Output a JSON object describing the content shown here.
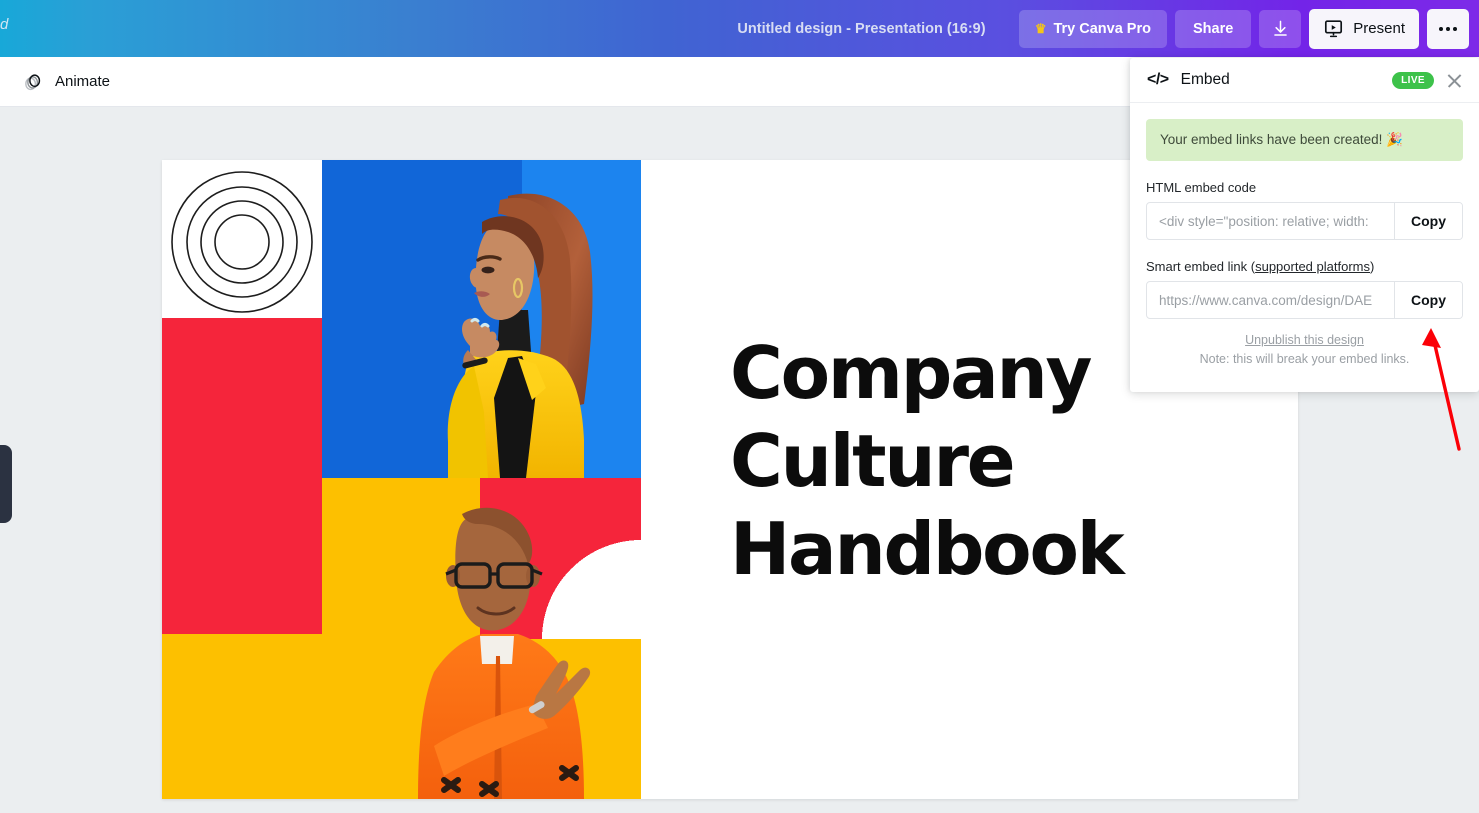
{
  "topbar": {
    "partial_text": "d",
    "doc_title": "Untitled design - Presentation (16:9)",
    "try_pro_label": "Try Canva Pro",
    "crown_icon": "crown-icon",
    "share_label": "Share",
    "download_icon": "download-icon",
    "present_label": "Present",
    "present_icon": "presentation-screen-icon",
    "more_icon": "more-options-icon",
    "gradient_start": "#18a8d8",
    "gradient_end": "#7d2ae8"
  },
  "toolbar": {
    "animate_label": "Animate",
    "animate_icon": "animate-circles-icon"
  },
  "canvas": {
    "background": "#ebeef0",
    "side_handle": "panel-collapse-handle"
  },
  "slide": {
    "title_lines": [
      "Company",
      "Culture",
      "Handbook"
    ],
    "colors": {
      "red": "#f5253b",
      "blue": "#1166d8",
      "blue_light": "#1c84ef",
      "yellow": "#fdc000",
      "orange": "#f4631e",
      "white": "#ffffff",
      "text": "#0c0c0c"
    }
  },
  "embed_panel": {
    "icon": "code-embed-icon",
    "title": "Embed",
    "live_badge": "LIVE",
    "close_icon": "close-icon",
    "success_message": "Your embed links have been created! 🎉",
    "html_embed": {
      "label": "HTML embed code",
      "value": "<div style=\"position: relative; width:",
      "copy_label": "Copy"
    },
    "smart_link": {
      "label_prefix": "Smart embed link (",
      "label_link": "supported platforms",
      "label_suffix": ")",
      "value": "https://www.canva.com/design/DAE",
      "copy_label": "Copy"
    },
    "unpublish_label": "Unpublish this design",
    "note": "Note: this will break your embed links.",
    "accent_live": "#3dc24a"
  },
  "annotation": {
    "arrow_color": "#fb0007",
    "arrow_name": "red-pointer-arrow"
  }
}
